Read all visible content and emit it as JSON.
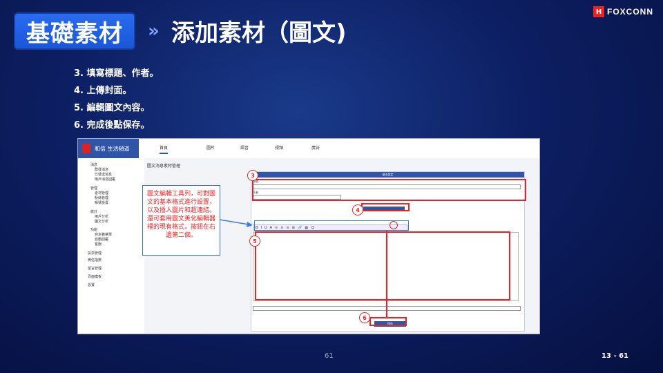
{
  "header": {
    "section_tag": "基礎素材",
    "arrow": "»",
    "title": "添加素材（圖文)"
  },
  "logo": {
    "text": "FOXCONN",
    "mark": "H"
  },
  "steps": [
    "3.  填寫標題、作者。",
    "4.  上傳封面。",
    "5.  編輯圖文內容。",
    "6.  完成後點保存。"
  ],
  "screenshot": {
    "brand": "和信  生活頻道",
    "tabs": [
      "首頁",
      "圖片",
      "語音",
      "視頻",
      "廣告"
    ],
    "content_title": "圖文消息素材管理",
    "sidebar": [
      "消息",
      "群發消息",
      "已發送消息",
      "用戶消息回覆",
      "管理",
      "素材管理",
      "粉絲管理",
      "帳號設置",
      "統計",
      "用戶分析",
      "圖文分析",
      "功能",
      "自定義菜單",
      "自動回覆",
      "客服",
      "投票管理",
      "微信指數",
      "留言管理",
      "頁面模板",
      "設置"
    ],
    "form_header": "基本設定",
    "title_placeholder": "標題",
    "author_placeholder": "作者",
    "toolbar_icons": [
      "B",
      "I",
      "U",
      "A",
      "≡",
      "≡",
      "≡",
      "☰",
      "🔗",
      "▦",
      "☺"
    ],
    "save_label": "保存"
  },
  "annotation": {
    "text": "圖文編輯工具列，可對圖文的基本格式進行設置，以及插入圖片和超連結。還可套用圖文美化編輯器裡的現有格式，按鈕在右邊第二個。"
  },
  "badges": [
    "3",
    "4",
    "5",
    "6"
  ],
  "footer": {
    "page": "61",
    "page_right": "13 - 61"
  }
}
